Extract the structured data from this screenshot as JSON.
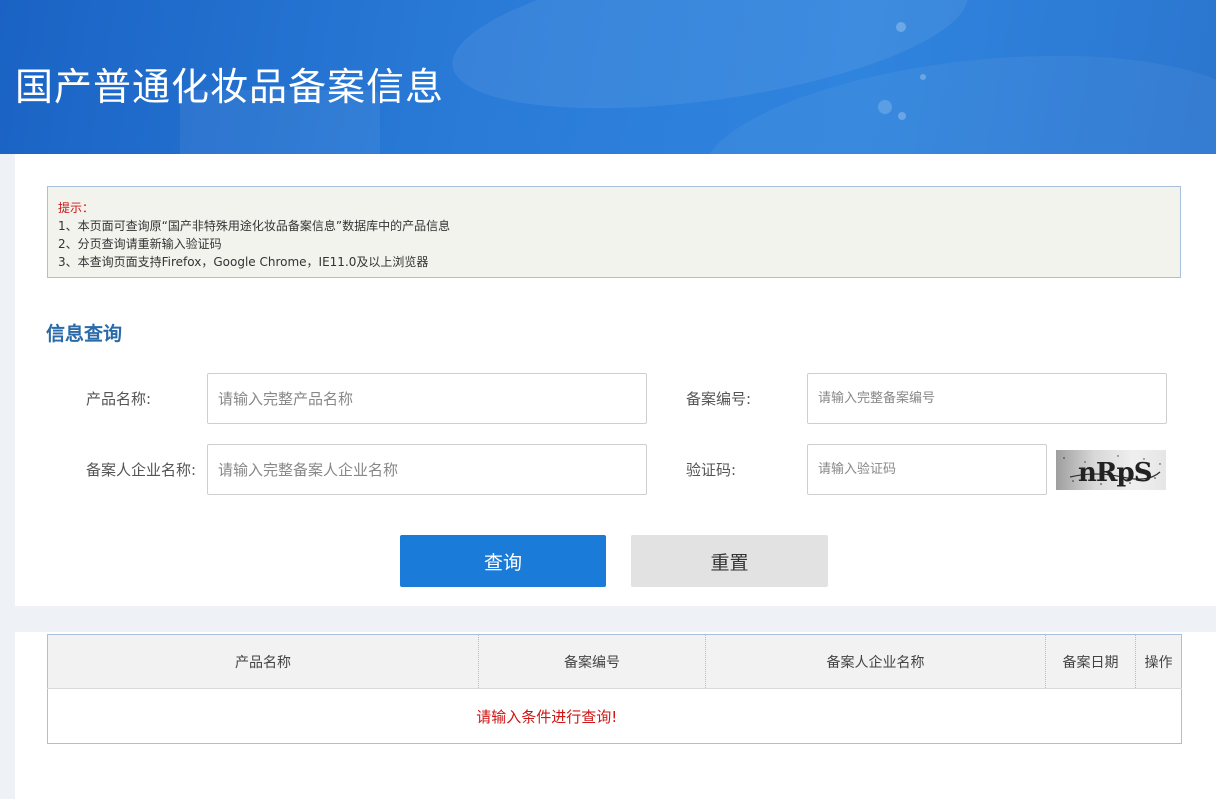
{
  "header": {
    "title": "国产普通化妆品备案信息"
  },
  "notice": {
    "title": "提示：",
    "lines": [
      "1、本页面可查询原“国产非特殊用途化妆品备案信息”数据库中的产品信息",
      "2、分页查询请重新输入验证码",
      "3、本查询页面支持Firefox，Google Chrome，IE11.0及以上浏览器"
    ]
  },
  "search": {
    "section_title": "信息查询",
    "fields": {
      "product_name": {
        "label": "产品名称:",
        "placeholder": "请输入完整产品名称",
        "value": ""
      },
      "record_number": {
        "label": "备案编号:",
        "placeholder": "请输入完整备案编号",
        "value": ""
      },
      "company_name": {
        "label": "备案人企业名称:",
        "placeholder": "请输入完整备案人企业名称",
        "value": ""
      },
      "captcha": {
        "label": "验证码:",
        "placeholder": "请输入验证码",
        "value": ""
      }
    },
    "captcha_image_text": "nRpS",
    "query_button": "查询",
    "reset_button": "重置"
  },
  "results": {
    "columns": [
      "产品名称",
      "备案编号",
      "备案人企业名称",
      "备案日期",
      "操作"
    ],
    "empty_message": "请输入条件进行查询!"
  },
  "colors": {
    "banner": "#2a7bd8",
    "primary_button": "#1a7bd8",
    "section_title": "#2a6aa8",
    "alert_red": "#d01414"
  }
}
